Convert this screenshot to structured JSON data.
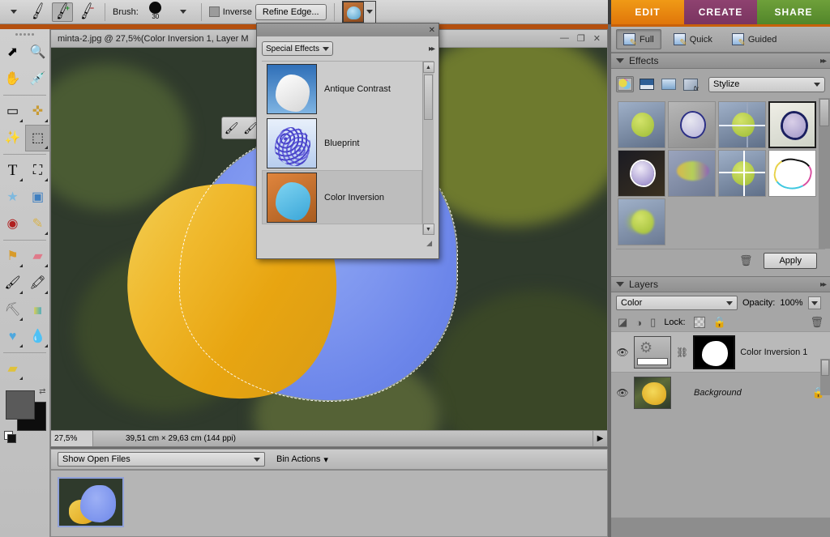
{
  "options_bar": {
    "brush_label": "Brush:",
    "brush_size": "30",
    "inverse_label": "Inverse",
    "refine_edge_label": "Refine Edge...",
    "selection_tools": [
      "brush-tool",
      "brush-add-tool",
      "brush-subtract-tool"
    ],
    "preset_name": "color-inversion-preset"
  },
  "toolbox": {
    "tools": [
      {
        "name": "move-tool",
        "glyph": "✥"
      },
      {
        "name": "zoom-tool",
        "glyph": "🔍"
      },
      {
        "name": "hand-tool",
        "glyph": "✋"
      },
      {
        "name": "eyedropper-tool",
        "glyph": "💊"
      },
      {
        "name": "rectangular-marquee-tool",
        "glyph": "▭"
      },
      {
        "name": "lasso-tool",
        "glyph": "✇"
      },
      {
        "name": "magic-wand-tool",
        "glyph": "✳"
      },
      {
        "name": "selection-brush-tool",
        "glyph": "❆"
      },
      {
        "name": "type-tool",
        "glyph": "T"
      },
      {
        "name": "crop-tool",
        "glyph": "⌗"
      },
      {
        "name": "cookie-cutter-tool",
        "glyph": "☆"
      },
      {
        "name": "straighten-tool",
        "glyph": "▣"
      },
      {
        "name": "red-eye-removal-tool",
        "glyph": "◉"
      },
      {
        "name": "healing-brush-tool",
        "glyph": "✐"
      },
      {
        "name": "clone-stamp-tool",
        "glyph": "⚑"
      },
      {
        "name": "eraser-tool",
        "glyph": "▱"
      },
      {
        "name": "brush-tool",
        "glyph": "✒"
      },
      {
        "name": "smart-brush-tool",
        "glyph": "⁂"
      },
      {
        "name": "paint-bucket-tool",
        "glyph": "⚒"
      },
      {
        "name": "gradient-tool",
        "glyph": "■"
      },
      {
        "name": "shape-tool",
        "glyph": "♥"
      },
      {
        "name": "blur-tool",
        "glyph": "💧"
      },
      {
        "name": "sponge-tool",
        "glyph": "▰"
      }
    ],
    "foreground_color": "#5a5a5a",
    "background_color": "#0d0d0d"
  },
  "document": {
    "title": "minta-2.jpg @ 27,5%(Color Inversion 1, Layer M",
    "minimize_label": "—",
    "restore_label": "❐",
    "close_label": "✕",
    "zoom_level": "27,5%",
    "dimensions": "39,51 cm × 29,63 cm (144 ppi)",
    "status_arrow": "▶"
  },
  "effects_dialog": {
    "close_label": "✕",
    "category": "Special Effects",
    "more_label": "▸▸",
    "scroll_up": "▲",
    "scroll_down": "▼",
    "items": [
      {
        "label": "Antique Contrast",
        "thumb": "th-antique",
        "selected": false
      },
      {
        "label": "Blueprint",
        "thumb": "th-blue",
        "selected": false
      },
      {
        "label": "Color Inversion",
        "thumb": "th-color",
        "selected": true
      }
    ]
  },
  "right_panel": {
    "modes": [
      {
        "label": "EDIT",
        "id": "mb-edit",
        "active": true
      },
      {
        "label": "CREATE",
        "id": "mb-create",
        "active": false
      },
      {
        "label": "SHARE",
        "id": "mb-share",
        "active": false
      }
    ],
    "subtabs": [
      {
        "label": "Full",
        "selected": true
      },
      {
        "label": "Quick",
        "selected": false
      },
      {
        "label": "Guided",
        "selected": false
      }
    ],
    "effects": {
      "header": "Effects",
      "more_label": "▸▸",
      "categories": [
        "photo-effects-icon",
        "layer-styles-icon",
        "frames-icon",
        "text-effects-icon"
      ],
      "selected_category_index": 0,
      "filter": "Stylize",
      "thumbnail_count": 9,
      "selected_thumbnail_index": 3,
      "apply_label": "Apply",
      "trash_label": "🗑"
    },
    "layers": {
      "header": "Layers",
      "more_label": "▸▸",
      "blend_mode": "Color",
      "opacity_label": "Opacity:",
      "opacity_value": "100%",
      "lock_label": "Lock:",
      "rows": [
        {
          "name": "Color Inversion 1",
          "italic": false,
          "selected": true,
          "visible": true,
          "locked": false,
          "type": "adjustment"
        },
        {
          "name": "Background",
          "italic": true,
          "selected": false,
          "visible": true,
          "locked": true,
          "type": "background"
        }
      ]
    }
  },
  "photo_bin": {
    "show_files": "Show Open Files",
    "bin_actions": "Bin Actions",
    "bin_actions_caret": "▾",
    "thumbnails": 1
  },
  "colors": {
    "edit_accent": "#e0760a",
    "create_accent": "#7a3460",
    "share_accent": "#52862a",
    "panel_bg": "#a6a6a6",
    "toolbar_orange": "#b4500f"
  }
}
